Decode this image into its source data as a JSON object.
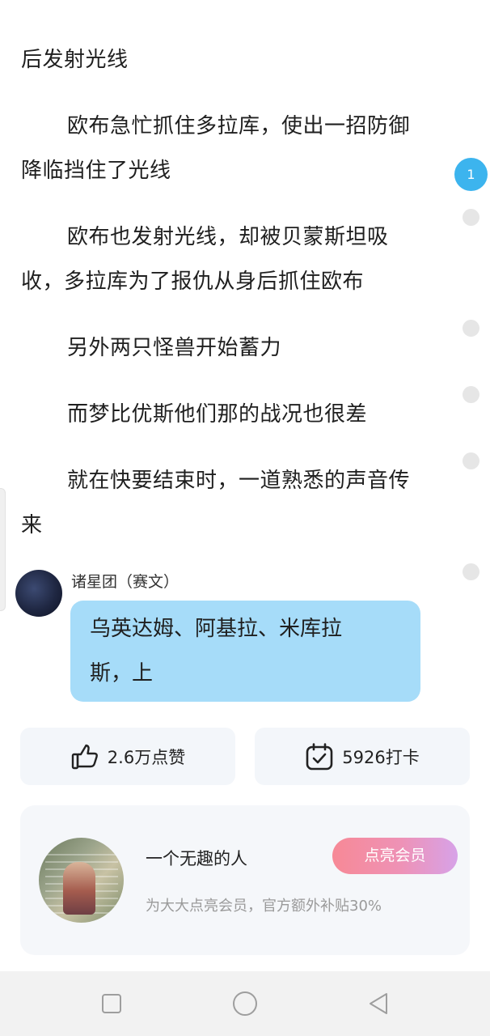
{
  "reader": {
    "paragraphs": [
      {
        "first": "后发射光线",
        "rest": ""
      },
      {
        "first": "欧布急忙抓住多拉库，使出一招防御",
        "rest": "降临挡住了光线"
      },
      {
        "first": "欧布也发射光线，却被贝蒙斯坦吸",
        "rest": "收，多拉库为了报仇从身后抓住欧布"
      },
      {
        "first": "另外两只怪兽开始蓄力",
        "rest": ""
      },
      {
        "first": "而梦比优斯他们那的战况也很差",
        "rest": ""
      },
      {
        "first": "就在快要结束时，一道熟悉的声音传",
        "rest": "来"
      }
    ],
    "comment_badge_count": "1"
  },
  "dialog": {
    "speaker": "诸星团（赛文）",
    "line1": "乌英达姆、阿基拉、米库拉",
    "line2": "斯，上"
  },
  "stats": {
    "likes_label": "2.6万点赞",
    "checkins_label": "5926打卡",
    "like_icon": "thumbs-up-icon",
    "checkin_icon": "calendar-check-icon"
  },
  "member": {
    "name": "一个无趣的人",
    "subtitle": "为大大点亮会员，官方额外补贴30%",
    "button_label": "点亮会员"
  },
  "navbar": {
    "icons": [
      "square-icon",
      "circle-icon",
      "back-triangle-icon"
    ]
  },
  "colors": {
    "accent_blue": "#3cb4ee",
    "bubble": "#a6dcf9",
    "member_button_start": "#f78996",
    "member_button_end": "#d7a2e8"
  }
}
